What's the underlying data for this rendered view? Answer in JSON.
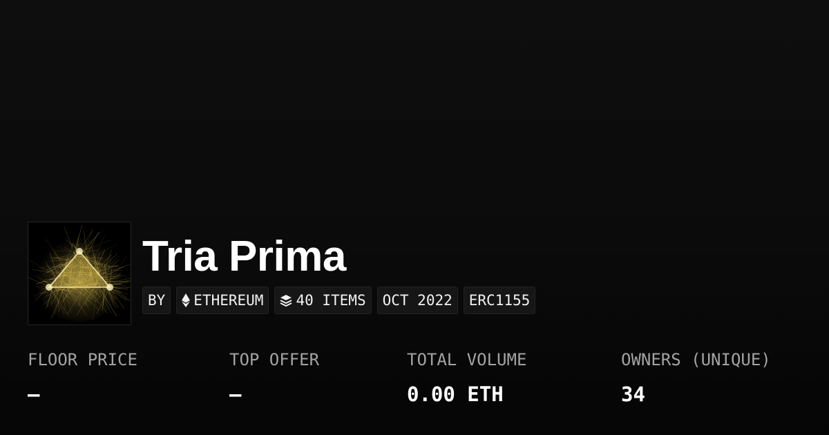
{
  "collection": {
    "name": "Tria Prima",
    "thumbnail_icon": "golden-triangle-artwork"
  },
  "badges": [
    {
      "label": "BY",
      "icon": ""
    },
    {
      "label": "ETHEREUM",
      "icon": "ethereum-icon"
    },
    {
      "label": "40 ITEMS",
      "icon": "layers-icon"
    },
    {
      "label": "OCT 2022",
      "icon": ""
    },
    {
      "label": "ERC1155",
      "icon": ""
    }
  ],
  "stats": [
    {
      "label": "FLOOR PRICE",
      "value": "–"
    },
    {
      "label": "TOP OFFER",
      "value": "–"
    },
    {
      "label": "TOTAL VOLUME",
      "value": "0.00 ETH"
    },
    {
      "label": "OWNERS (UNIQUE)",
      "value": "34"
    }
  ],
  "colors": {
    "background": "#0b0b0b",
    "badge_background": "#161616",
    "label_gray": "#a3a3a3",
    "artwork_gold": "#f2d25a"
  }
}
